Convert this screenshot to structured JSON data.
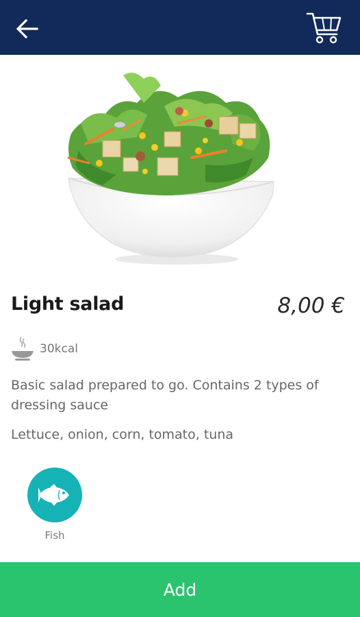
{
  "header": {
    "back_icon": "arrow-left-icon",
    "cart_icon": "shopping-cart-icon",
    "background_color": "#112a5a"
  },
  "product": {
    "image": "salad-bowl-image",
    "name": "Light salad",
    "price": "8,00 €",
    "calories": "30kcal",
    "calories_icon": "steaming-bowl-icon",
    "description": "Basic salad prepared to go. Contains 2 types of dressing sauce",
    "ingredients": "Lettuce, onion, corn, tomato, tuna",
    "allergens": [
      {
        "label": "Fish",
        "icon": "fish-icon",
        "color": "#15b3b6"
      }
    ]
  },
  "footer": {
    "add_label": "Add",
    "color": "#2bc46e"
  }
}
